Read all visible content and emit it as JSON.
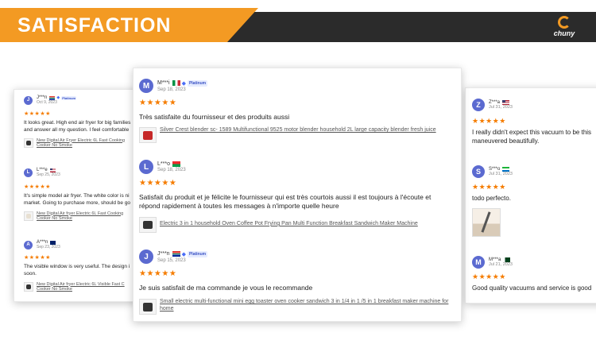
{
  "banner": {
    "title": "SATISFACTION",
    "logo_text": "chuny",
    "logo_icon": "chuny-logo-icon"
  },
  "colors": {
    "accent": "#f39a23",
    "banner_dark": "#2b2b2b",
    "stars": "#f57c00",
    "avatar": "#5b6ad0"
  },
  "left_card": {
    "reviews": [
      {
        "initial": "J",
        "name": "J***n",
        "date": "Oct 9, 2023",
        "badge": "Platinum",
        "stars": "★★★★★",
        "text_lines": [
          "It looks great. High end air fryer for big families",
          "and answer all my question. I feel comfortable"
        ],
        "product_lines": [
          "New Digital Air Fryer Electric 6L Fast Cooking",
          "Cooker No Smoke"
        ]
      },
      {
        "initial": "L",
        "name": "L***e",
        "date": "Sep 25, 2023",
        "stars": "★★★★★",
        "text_lines": [
          "It's simple model air fryer. The white color is ni",
          "market. Going to purchase more, should be go"
        ],
        "product_lines": [
          "New Digital Air fryer Electric 6L Fast Cooking",
          "Cooker No Smoke"
        ]
      },
      {
        "initial": "A",
        "name": "A***n",
        "date": "Sep 23, 2023",
        "stars": "★★★★★",
        "text_lines": [
          "The visible window is very useful. The design i",
          "soon."
        ],
        "product_lines": [
          "New Digital Air fryer Electric 6L Visible Fast C",
          "Cooker No Smoke"
        ]
      }
    ]
  },
  "center_card": {
    "reviews": [
      {
        "initial": "M",
        "name": "M***i",
        "date": "Sep 18, 2023",
        "badge": "Platinum",
        "stars": "★★★★★",
        "text": "Très satisfaite du fournisseur et des produits aussi",
        "product": "Silver Crest blender sc- 1589 Multifunctional 9525 motor blender household 2L large capacity blender fresh juice"
      },
      {
        "initial": "L",
        "name": "L***o",
        "date": "Sep 18, 2023",
        "stars": "★★★★★",
        "text": "Satisfait du produit et je félicite le fournisseur qui est très courtois aussi il est toujours à l'écoute et répond rapidement à toutes les messages à n'importe quelle heure",
        "product": "Electric 3 in 1 household Oven Coffee Pot Frying Pan Multi Function Breakfast Sandwich Maker Machine"
      },
      {
        "initial": "J",
        "name": "J***n",
        "date": "Sep 15, 2023",
        "badge": "Platinum",
        "stars": "★★★★★",
        "text": "Je suis satisfait de ma commande je vous le recommande",
        "product": "Small electric multi-functional mini egg toaster oven cooker sandwich 3 in 1/4 in 1 /5 in 1 breakfast maker machine for home"
      }
    ]
  },
  "right_card": {
    "reviews": [
      {
        "initial": "Z",
        "name": "Z***a",
        "date": "Jul 31, 2023",
        "stars": "★★★★★",
        "text_lines": [
          "I really didn't expect this vacuum to be this",
          "maneuvered beautifully."
        ]
      },
      {
        "initial": "S",
        "name": "S***o",
        "date": "Jul 31, 2023",
        "stars": "★★★★★",
        "text_lines": [
          "todo perfecto."
        ]
      },
      {
        "initial": "M",
        "name": "M***a",
        "date": "Jul 21, 2023",
        "stars": "★★★★★",
        "text_lines": [
          "Good quality vacuums and service is good"
        ]
      }
    ]
  }
}
